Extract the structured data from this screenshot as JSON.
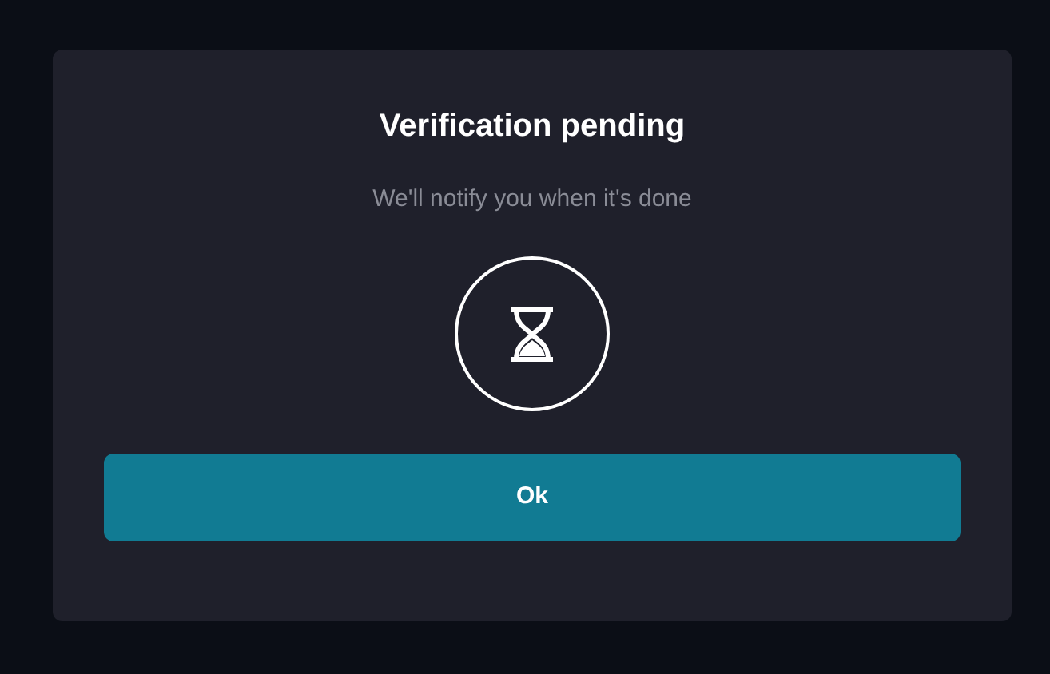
{
  "dialog": {
    "title": "Verification pending",
    "message": "We'll notify you when it's done",
    "buttons": [
      "Ok"
    ]
  }
}
